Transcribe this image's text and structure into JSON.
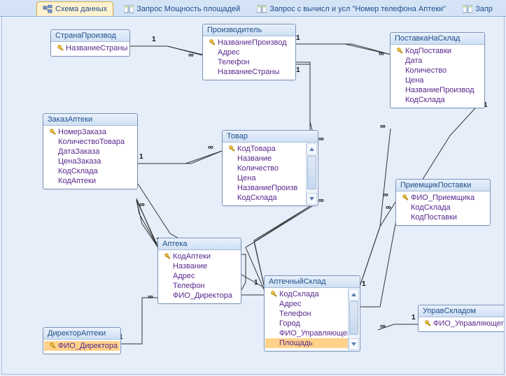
{
  "tabs": {
    "active": "Схема данных",
    "inactive": [
      "Запрос Мощность площадей",
      "Запрос с вычисл и усл \"Номер телефона Аптеки\"",
      "Запр"
    ]
  },
  "tables": {
    "t_country": {
      "title": "СтранаПроизвод",
      "fields": [
        {
          "name": "НазваниеСтраны",
          "key": true
        }
      ]
    },
    "t_manufacturer": {
      "title": "Производитель",
      "fields": [
        {
          "name": "НазваниеПроизвод",
          "key": true
        },
        {
          "name": "Адрес",
          "key": false
        },
        {
          "name": "Телефон",
          "key": false
        },
        {
          "name": "НазваниеСтраны",
          "key": false
        }
      ]
    },
    "t_supply": {
      "title": "ПоставкаНаСклад",
      "fields": [
        {
          "name": "КодПоставки",
          "key": true
        },
        {
          "name": "Дата",
          "key": false
        },
        {
          "name": "Количество",
          "key": false
        },
        {
          "name": "Цена",
          "key": false
        },
        {
          "name": "НазваниеПроизвод",
          "key": false
        },
        {
          "name": "КодСклада",
          "key": false
        }
      ]
    },
    "t_order": {
      "title": "ЗаказАптеки",
      "fields": [
        {
          "name": "НомерЗаказа",
          "key": true
        },
        {
          "name": "КоличествоТовара",
          "key": false
        },
        {
          "name": "ДатаЗаказа",
          "key": false
        },
        {
          "name": "ЦенаЗаказа",
          "key": false
        },
        {
          "name": "КодСклада",
          "key": false
        },
        {
          "name": "КодАптеки",
          "key": false
        }
      ]
    },
    "t_product": {
      "title": "Товар",
      "fields": [
        {
          "name": "КодТовара",
          "key": true
        },
        {
          "name": "Название",
          "key": false
        },
        {
          "name": "Количество",
          "key": false
        },
        {
          "name": "Цена",
          "key": false
        },
        {
          "name": "НазваниеПроизв",
          "key": false
        },
        {
          "name": "КодСклада",
          "key": false
        }
      ]
    },
    "t_receiver": {
      "title": "ПриемщикПоставки",
      "fields": [
        {
          "name": "ФИО_Приемщика",
          "key": true
        },
        {
          "name": "КодСклада",
          "key": false
        },
        {
          "name": "КодПоставки",
          "key": false
        }
      ]
    },
    "t_pharmacy": {
      "title": "Аптека",
      "fields": [
        {
          "name": "КодАптеки",
          "key": true
        },
        {
          "name": "Название",
          "key": false
        },
        {
          "name": "Адрес",
          "key": false
        },
        {
          "name": "Телефон",
          "key": false
        },
        {
          "name": "ФИО_Директора",
          "key": false
        }
      ]
    },
    "t_warehouse": {
      "title": "АптечныйСклад",
      "fields": [
        {
          "name": "КодСклада",
          "key": true
        },
        {
          "name": "Адрес",
          "key": false
        },
        {
          "name": "Телефон",
          "key": false
        },
        {
          "name": "Город",
          "key": false
        },
        {
          "name": "ФИО_Управляющего",
          "key": false
        },
        {
          "name": "Площадь",
          "key": false,
          "selected": true
        }
      ]
    },
    "t_director": {
      "title": "ДиректорАптеки",
      "fields": [
        {
          "name": "ФИО_Директора",
          "key": true,
          "selected": true
        }
      ]
    },
    "t_manager": {
      "title": "УправСкладом",
      "fields": [
        {
          "name": "ФИО_Управляющего",
          "key": true
        }
      ]
    }
  },
  "relationships": [
    {
      "from": "t_country",
      "to": "t_manufacturer",
      "fcard": "1",
      "tcard": "∞"
    },
    {
      "from": "t_manufacturer",
      "to": "t_supply",
      "fcard": "1",
      "tcard": "∞"
    },
    {
      "from": "t_manufacturer",
      "to": "t_product",
      "fcard": "1",
      "tcard": "∞"
    },
    {
      "from": "t_order",
      "to": "t_product",
      "fcard": "1",
      "tcard": "∞"
    },
    {
      "from": "t_pharmacy",
      "to": "t_order",
      "fcard": "1",
      "tcard": "∞"
    },
    {
      "from": "t_director",
      "to": "t_pharmacy",
      "fcard": "1",
      "tcard": "∞"
    },
    {
      "from": "t_warehouse",
      "to": "t_product",
      "fcard": "1",
      "tcard": "∞"
    },
    {
      "from": "t_warehouse",
      "to": "t_order",
      "fcard": "1",
      "tcard": "∞"
    },
    {
      "from": "t_warehouse",
      "to": "t_supply",
      "fcard": "1",
      "tcard": "∞"
    },
    {
      "from": "t_warehouse",
      "to": "t_receiver",
      "fcard": "1",
      "tcard": "∞"
    },
    {
      "from": "t_supply",
      "to": "t_receiver",
      "fcard": "1",
      "tcard": "∞"
    },
    {
      "from": "t_manager",
      "to": "t_warehouse",
      "fcard": "1",
      "tcard": "∞"
    },
    {
      "from": "t_warehouse",
      "to": "t_pharmacy",
      "fcard": "",
      "tcard": ""
    }
  ],
  "glyphs": {
    "schema": "⊞",
    "query": "SQL"
  }
}
